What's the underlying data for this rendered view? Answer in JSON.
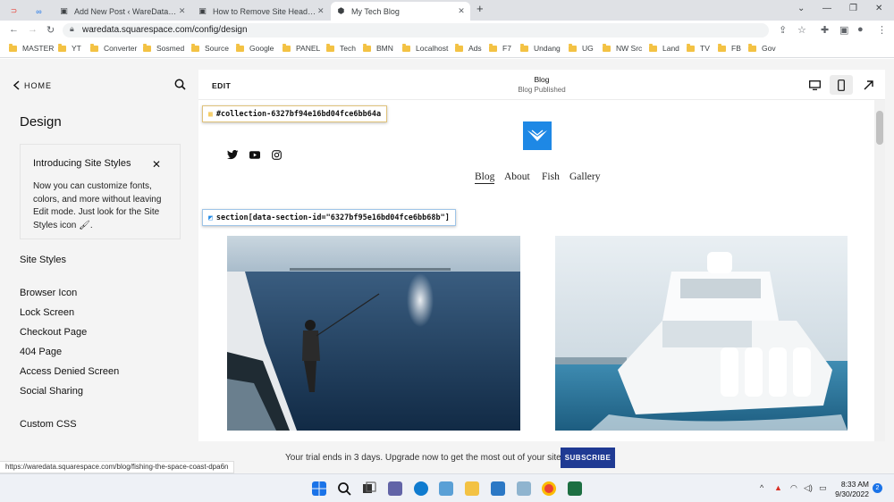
{
  "browser": {
    "tabs": [
      {
        "title": "",
        "icon": "red-app-icon"
      },
      {
        "title": "",
        "icon": "link-icon"
      },
      {
        "title": "Add New Post ‹ WareData — W",
        "icon": "squarespace-icon"
      },
      {
        "title": "How to Remove Site Header Squ",
        "icon": "squarespace-icon"
      },
      {
        "title": "My Tech Blog",
        "icon": "cube-icon"
      }
    ],
    "url": "waredata.squarespace.com/config/design",
    "bookmarks": [
      "MASTER",
      "YT",
      "Converter",
      "Sosmed",
      "Source",
      "Google",
      "PANEL",
      "Tech",
      "BMN",
      "Localhost",
      "Ads",
      "F7",
      "Undang",
      "UG",
      "NW Src",
      "Land",
      "TV",
      "FB",
      "Gov"
    ]
  },
  "left_panel": {
    "home_label": "HOME",
    "title": "Design",
    "info": {
      "heading": "Introducing Site Styles",
      "body": "Now you can customize fonts, colors, and more without leaving Edit mode. Just look for the Site Styles icon",
      "body_end": "."
    },
    "menu": [
      "Site Styles",
      "Browser Icon",
      "Lock Screen",
      "Checkout Page",
      "404 Page",
      "Access Denied Screen",
      "Social Sharing",
      "Custom CSS"
    ]
  },
  "preview": {
    "edit_label": "EDIT",
    "page_title": "Blog",
    "page_sub": "Blog  Published",
    "collection_tag": "#collection-6327bf94e16bd04fce6bb64a",
    "section_tag": "section[data-section-id=\"6327bf95e16bd04fce6bb68b\"]",
    "site_nav": [
      "Blog",
      "About",
      "Fish",
      "Gallery"
    ],
    "accent": "#1e88e5"
  },
  "trial": {
    "text": "Your trial ends in 3 days. Upgrade now to get the most out of your site.",
    "button": "SUBSCRIBE"
  },
  "status_url": "https://waredata.squarespace.com/blog/fishing-the-space-coast-dpa6n",
  "taskbar": {
    "time": "8:33 AM",
    "date": "9/30/2022",
    "notifications": "2"
  }
}
